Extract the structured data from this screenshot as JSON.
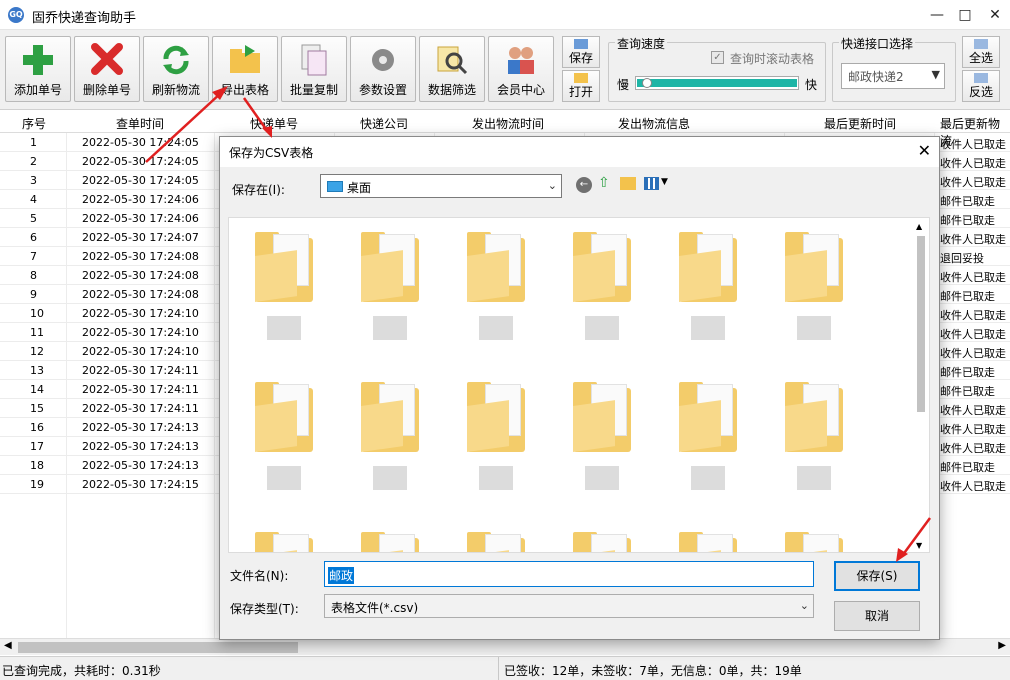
{
  "window": {
    "title": "固乔快递查询助手",
    "app_icon": "app-logo-icon"
  },
  "toolbar": {
    "buttons": [
      {
        "label": "添加单号",
        "icon": "add-icon"
      },
      {
        "label": "删除单号",
        "icon": "delete-icon"
      },
      {
        "label": "刷新物流",
        "icon": "refresh-icon"
      },
      {
        "label": "导出表格",
        "icon": "export-folder-icon"
      },
      {
        "label": "批量复制",
        "icon": "copy-icon"
      },
      {
        "label": "参数设置",
        "icon": "gear-icon"
      },
      {
        "label": "数据筛选",
        "icon": "filter-search-icon"
      },
      {
        "label": "会员中心",
        "icon": "member-icon"
      }
    ],
    "save_label": "保存",
    "open_label": "打开",
    "speed_group_title": "查询速度",
    "scroll_checkbox_label": "查询时滚动表格",
    "slow_label": "慢",
    "fast_label": "快",
    "interface_group_title": "快递接口选择",
    "interface_selected": "邮政快递2",
    "select_all_label": "全选",
    "invert_label": "反选"
  },
  "table": {
    "columns": [
      "序号",
      "查单时间",
      "快递单号",
      "快递公司",
      "发出物流时间",
      "发出物流信息",
      "最后更新时间",
      "最后更新物流"
    ],
    "rows": [
      {
        "no": "1",
        "time": "2022-05-30  17:24:05",
        "last": "收件人已取走"
      },
      {
        "no": "2",
        "time": "2022-05-30  17:24:05",
        "last": "收件人已取走"
      },
      {
        "no": "3",
        "time": "2022-05-30  17:24:05",
        "last": "收件人已取走"
      },
      {
        "no": "4",
        "time": "2022-05-30  17:24:06",
        "last": "邮件已取走"
      },
      {
        "no": "5",
        "time": "2022-05-30  17:24:06",
        "last": "邮件已取走"
      },
      {
        "no": "6",
        "time": "2022-05-30  17:24:07",
        "last": "收件人已取走"
      },
      {
        "no": "7",
        "time": "2022-05-30  17:24:08",
        "last": "退回妥投"
      },
      {
        "no": "8",
        "time": "2022-05-30  17:24:08",
        "last": "收件人已取走"
      },
      {
        "no": "9",
        "time": "2022-05-30  17:24:08",
        "last": "邮件已取走"
      },
      {
        "no": "10",
        "time": "2022-05-30  17:24:10",
        "last": "收件人已取走"
      },
      {
        "no": "11",
        "time": "2022-05-30  17:24:10",
        "last": "收件人已取走"
      },
      {
        "no": "12",
        "time": "2022-05-30  17:24:10",
        "last": "收件人已取走"
      },
      {
        "no": "13",
        "time": "2022-05-30  17:24:11",
        "last": "邮件已取走"
      },
      {
        "no": "14",
        "time": "2022-05-30  17:24:11",
        "last": "邮件已取走"
      },
      {
        "no": "15",
        "time": "2022-05-30  17:24:11",
        "last": "收件人已取走"
      },
      {
        "no": "16",
        "time": "2022-05-30  17:24:13",
        "last": "收件人已取走"
      },
      {
        "no": "17",
        "time": "2022-05-30  17:24:13",
        "last": "收件人已取走"
      },
      {
        "no": "18",
        "time": "2022-05-30  17:24:13",
        "last": "邮件已取走"
      },
      {
        "no": "19",
        "time": "2022-05-30  17:24:15",
        "last": "收件人已取走"
      }
    ]
  },
  "status": {
    "left": "已查询完成，共耗时：0.31秒",
    "right": "已签收：12单，未签收：7单，无信息：0单，共：19单"
  },
  "dialog": {
    "title": "保存为CSV表格",
    "save_in_label": "保存在(I):",
    "save_in_value": "桌面",
    "filename_label": "文件名(N):",
    "filename_value": "邮政",
    "filetype_label": "保存类型(T):",
    "filetype_value": "表格文件(*.csv)",
    "save_button": "保存(S)",
    "cancel_button": "取消",
    "close_icon": "close-icon"
  },
  "colors": {
    "accent": "#0078d7",
    "annotation_arrow": "#e02020",
    "folder": "#f3cc6a"
  }
}
